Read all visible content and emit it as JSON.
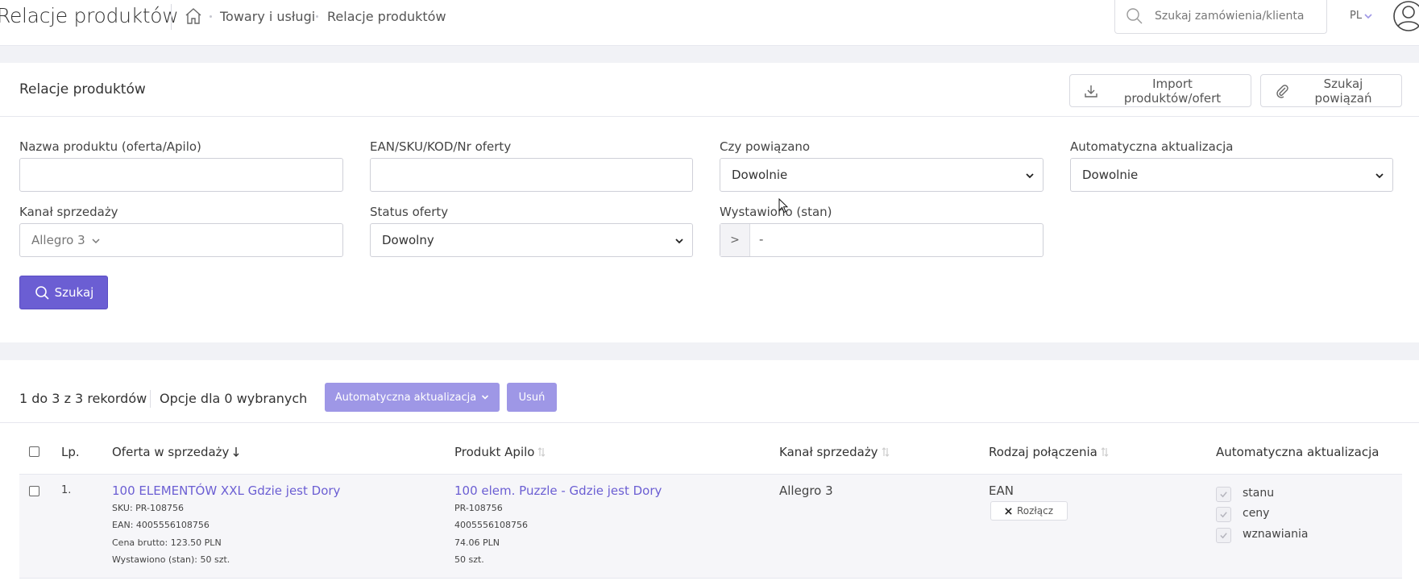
{
  "header": {
    "title": "Relacje produktów",
    "breadcrumbs": [
      "Towary i usługi",
      "Relacje produktów"
    ],
    "search_placeholder": "Szukaj zamówienia/klienta",
    "language": "PL"
  },
  "filters": {
    "card_title": "Relacje produktów",
    "import_button": "Import produktów/ofert",
    "search_links_button": "Szukaj powiązań",
    "product_name_label": "Nazwa produktu (oferta/Apilo)",
    "product_name_value": "",
    "ean_label": "EAN/SKU/KOD/Nr oferty",
    "ean_value": "",
    "linked_label": "Czy powiązano",
    "linked_value": "Dowolnie",
    "auto_update_label": "Automatyczna aktualizacja",
    "auto_update_value": "Dowolnie",
    "channel_label": "Kanał sprzedaży",
    "channel_value": "Allegro 3",
    "offer_status_label": "Status oferty",
    "offer_status_value": "Dowolny",
    "listed_label": "Wystawiono (stan)",
    "listed_operator": ">",
    "listed_value": "-",
    "search_button": "Szukaj"
  },
  "results": {
    "record_count": "1 do 3 z 3 rekordów",
    "options_label": "Opcje dla 0 wybranych",
    "auto_update_button": "Automatyczna aktualizacja",
    "delete_button": "Usuń",
    "columns": [
      "Lp.",
      "Oferta w sprzedaży",
      "Produkt Apilo",
      "Kanał sprzedaży",
      "Rodzaj połączenia",
      "Automatyczna aktualizacja"
    ],
    "rows": [
      {
        "index": "1.",
        "offer_name": "100 ELEMENTÓW XXL Gdzie jest Dory",
        "offer_sku": "SKU: PR-108756",
        "offer_ean": "EAN: 4005556108756",
        "offer_price": "Cena brutto: 123.50 PLN",
        "offer_stock": "Wystawiono (stan): 50 szt.",
        "product_name": "100 elem. Puzzle - Gdzie jest Dory",
        "product_sku": "PR-108756",
        "product_ean": "4005556108756",
        "product_price": "74.06 PLN",
        "product_stock": "50 szt.",
        "channel": "Allegro 3",
        "connection_type": "EAN",
        "disconnect_button": "Rozłącz",
        "auto_update": [
          "stanu",
          "ceny",
          "wznawiania"
        ]
      }
    ]
  },
  "colors": {
    "primary": "#6b5ed3",
    "primary_soft": "#9e97e6",
    "link": "#6b5ed3",
    "background": "#f1f2f6"
  }
}
